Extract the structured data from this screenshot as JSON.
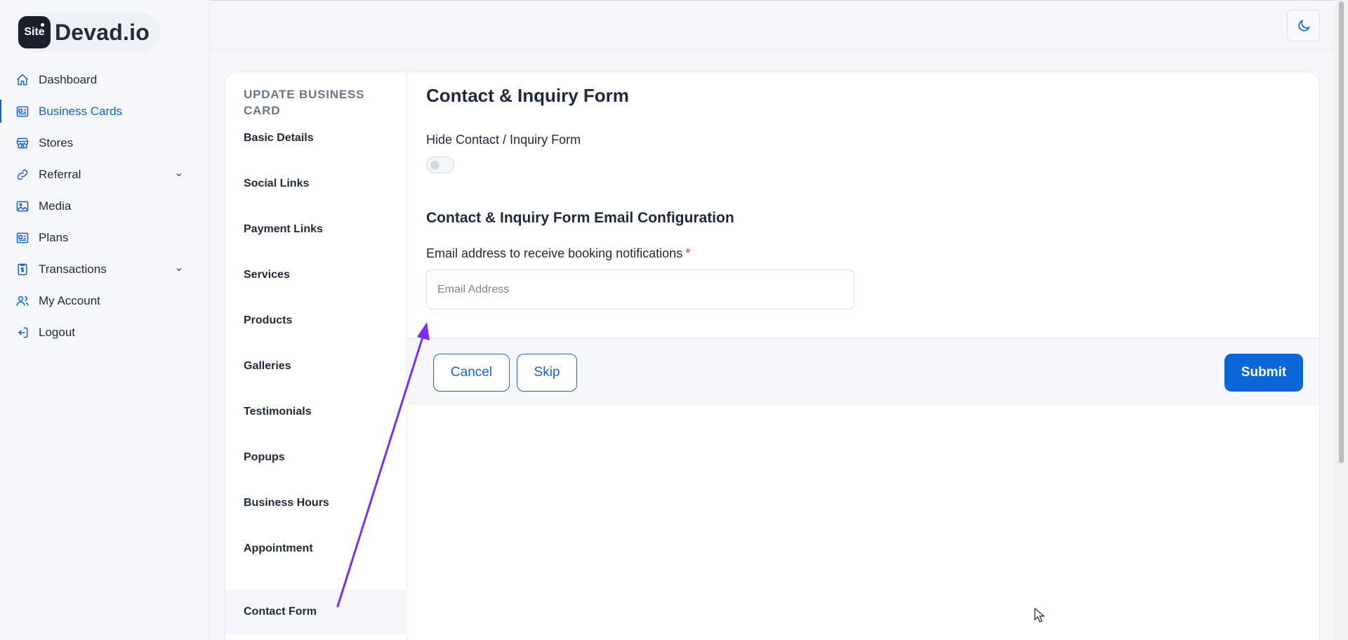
{
  "brand": {
    "logo_mark": "Site",
    "name": "Devad.io"
  },
  "sidebar": {
    "items": [
      {
        "label": "Dashboard",
        "icon": "home-icon"
      },
      {
        "label": "Business Cards",
        "icon": "id-card-icon",
        "active": true
      },
      {
        "label": "Stores",
        "icon": "store-icon"
      },
      {
        "label": "Referral",
        "icon": "link-icon",
        "expandable": true
      },
      {
        "label": "Media",
        "icon": "image-icon"
      },
      {
        "label": "Plans",
        "icon": "plan-card-icon"
      },
      {
        "label": "Transactions",
        "icon": "receipt-icon",
        "expandable": true
      },
      {
        "label": "My Account",
        "icon": "users-icon"
      },
      {
        "label": "Logout",
        "icon": "logout-icon"
      }
    ]
  },
  "header": {
    "theme_toggle_icon": "moon-icon"
  },
  "subnav": {
    "title": "UPDATE BUSINESS CARD",
    "items": [
      "Basic Details",
      "Social Links",
      "Payment Links",
      "Services",
      "Products",
      "Galleries",
      "Testimonials",
      "Popups",
      "Business Hours",
      "Appointment",
      "Contact Form"
    ],
    "active": "Contact Form"
  },
  "form": {
    "title": "Contact & Inquiry Form",
    "toggle_label": "Hide Contact / Inquiry Form",
    "toggle_on": false,
    "section_title": "Contact & Inquiry Form Email Configuration",
    "email_label": "Email address to receive booking notifications",
    "required_mark": "*",
    "email_value": "",
    "email_placeholder": "Email Address"
  },
  "actions": {
    "cancel": "Cancel",
    "skip": "Skip",
    "submit": "Submit"
  },
  "colors": {
    "accent": "#0b66d6",
    "annotation": "#7b2ff2",
    "required": "#d93a3a"
  }
}
